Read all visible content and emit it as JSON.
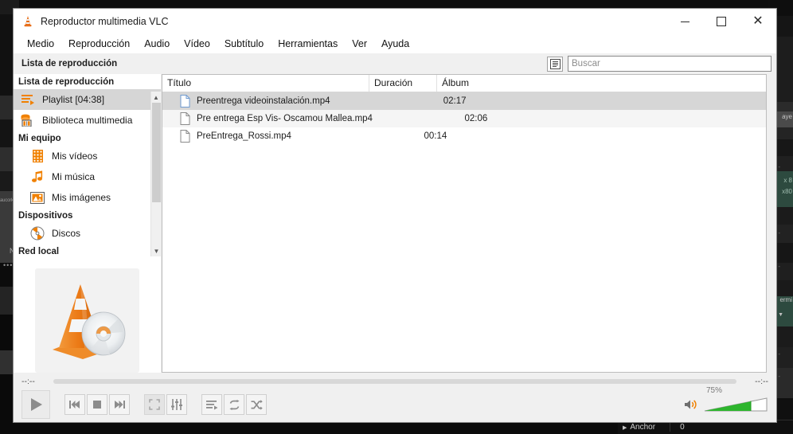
{
  "window": {
    "title": "Reproductor multimedia VLC",
    "app_icon": "vlc-cone-icon",
    "controls": {
      "minimize": "minimize-icon",
      "maximize": "maximize-icon",
      "close": "close-icon"
    }
  },
  "menubar": {
    "items": [
      {
        "label": "Medio"
      },
      {
        "label": "Reproducción"
      },
      {
        "label": "Audio"
      },
      {
        "label": "Vídeo"
      },
      {
        "label": "Subtítulo"
      },
      {
        "label": "Herramientas"
      },
      {
        "label": "Ver"
      },
      {
        "label": "Ayuda"
      }
    ]
  },
  "toolbar": {
    "panel_title": "Lista de reproducción",
    "view_mode_icon": "list-view-icon",
    "search": {
      "placeholder": "Buscar",
      "value": ""
    }
  },
  "sidebar": {
    "groups": [
      {
        "label": "Lista de reproducción",
        "items": [
          {
            "label": "Playlist [04:38]",
            "icon": "playlist-icon",
            "selected": true
          },
          {
            "label": "Biblioteca multimedia",
            "icon": "media-library-icon",
            "selected": false
          }
        ]
      },
      {
        "label": "Mi equipo",
        "items": [
          {
            "label": "Mis vídeos",
            "icon": "film-strip-icon",
            "selected": false
          },
          {
            "label": "Mi música",
            "icon": "music-note-icon",
            "selected": false
          },
          {
            "label": "Mis imágenes",
            "icon": "picture-icon",
            "selected": false
          }
        ]
      },
      {
        "label": "Dispositivos",
        "items": [
          {
            "label": "Discos",
            "icon": "disc-icon",
            "selected": false
          }
        ]
      },
      {
        "label": "Red local",
        "items": []
      }
    ],
    "scrollbar": {
      "up_arrow": "chevron-up-icon",
      "down_arrow": "chevron-down-icon"
    },
    "artwork": "vlc-cone-artwork"
  },
  "playlist": {
    "columns": [
      {
        "key": "title",
        "label": "Título"
      },
      {
        "key": "duration",
        "label": "Duración"
      },
      {
        "key": "album",
        "label": "Álbum"
      }
    ],
    "rows": [
      {
        "title": "Preentrega videoinstalación.mp4",
        "duration": "02:17",
        "album": "",
        "selected": true
      },
      {
        "title": "Pre entrega Esp Vis- Oscamou Mallea.mp4",
        "duration": "02:06",
        "album": "",
        "selected": false
      },
      {
        "title": "PreEntrega_Rossi.mp4",
        "duration": "00:14",
        "album": "",
        "selected": false
      }
    ]
  },
  "player": {
    "elapsed": "--:--",
    "remaining": "--:--",
    "progress_percent": 0,
    "buttons": [
      {
        "name": "play-button",
        "icon": "play-icon"
      },
      {
        "name": "previous-button",
        "icon": "previous-icon"
      },
      {
        "name": "stop-button",
        "icon": "stop-icon"
      },
      {
        "name": "next-button",
        "icon": "next-icon"
      },
      {
        "name": "fullscreen-button",
        "icon": "fullscreen-icon"
      },
      {
        "name": "extended-settings-button",
        "icon": "equalizer-icon"
      },
      {
        "name": "toggle-playlist-button",
        "icon": "playlist-toggle-icon"
      },
      {
        "name": "loop-button",
        "icon": "loop-icon"
      },
      {
        "name": "random-button",
        "icon": "shuffle-icon"
      }
    ],
    "volume": {
      "label": "75%",
      "value": 75,
      "icon": "speaker-icon",
      "fill_color": "#2db52d"
    }
  },
  "background": {
    "left_app_text": "aucork\nvice\nerface",
    "left_app_letter": "N",
    "right_app_labels": [
      "aye",
      "x 8",
      "x80",
      "ermi"
    ],
    "status_bar": {
      "arrow": "triangle-right-icon",
      "label": "Anchor",
      "value": "0"
    }
  }
}
